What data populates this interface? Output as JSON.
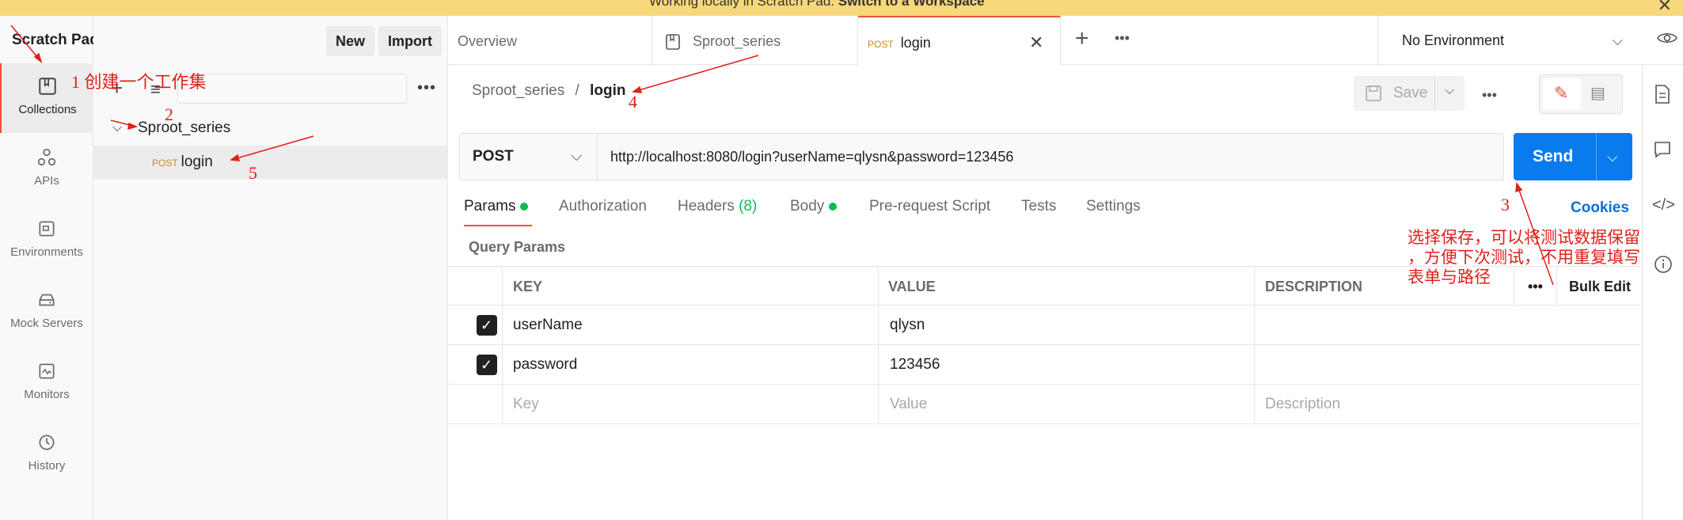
{
  "banner": {
    "prefix": "Working locally in Scratch Pad.",
    "link": "Switch to a Workspace"
  },
  "app": {
    "title": "Scratch Pad",
    "new_label": "New",
    "import_label": "Import"
  },
  "rail": {
    "items": [
      {
        "label": "Collections",
        "icon": "collections-icon"
      },
      {
        "label": "APIs",
        "icon": "apis-icon"
      },
      {
        "label": "Environments",
        "icon": "environments-icon"
      },
      {
        "label": "Mock Servers",
        "icon": "mock-servers-icon"
      },
      {
        "label": "Monitors",
        "icon": "monitors-icon"
      },
      {
        "label": "History",
        "icon": "history-icon"
      }
    ]
  },
  "collections": {
    "folder": "Sproot_series",
    "request_method": "POST",
    "request_name": "login"
  },
  "tabs": [
    {
      "label": "Overview"
    },
    {
      "label": "Sproot_series"
    },
    {
      "method": "POST",
      "label": "login"
    }
  ],
  "environment": "No Environment",
  "breadcrumb": {
    "parent": "Sproot_series",
    "separator": "/",
    "current": "login"
  },
  "toolbar": {
    "save_label": "Save"
  },
  "request": {
    "method": "POST",
    "url": "http://localhost:8080/login?userName=qlysn&password=123456",
    "send_label": "Send"
  },
  "subtabs": {
    "params": "Params",
    "authorization": "Authorization",
    "headers": "Headers",
    "headers_count": "(8)",
    "body": "Body",
    "prerequest": "Pre-request Script",
    "tests": "Tests",
    "settings": "Settings",
    "cookies": "Cookies"
  },
  "query_params": {
    "title": "Query Params",
    "columns": {
      "key": "KEY",
      "value": "VALUE",
      "description": "DESCRIPTION",
      "bulk_edit": "Bulk Edit"
    },
    "rows": [
      {
        "key": "userName",
        "value": "qlysn",
        "checked": true
      },
      {
        "key": "password",
        "value": "123456",
        "checked": true
      }
    ],
    "placeholders": {
      "key": "Key",
      "value": "Value",
      "description": "Description"
    }
  },
  "annotations": {
    "n1": "1",
    "n1_text": "创建一个工作集",
    "n2": "2",
    "n3": "3",
    "n4": "4",
    "n5": "5",
    "note_line1": "选择保存，可以将测试数据保留",
    "note_line2": "，方便下次测试，不用重复填写",
    "note_line3": "表单与路径"
  }
}
